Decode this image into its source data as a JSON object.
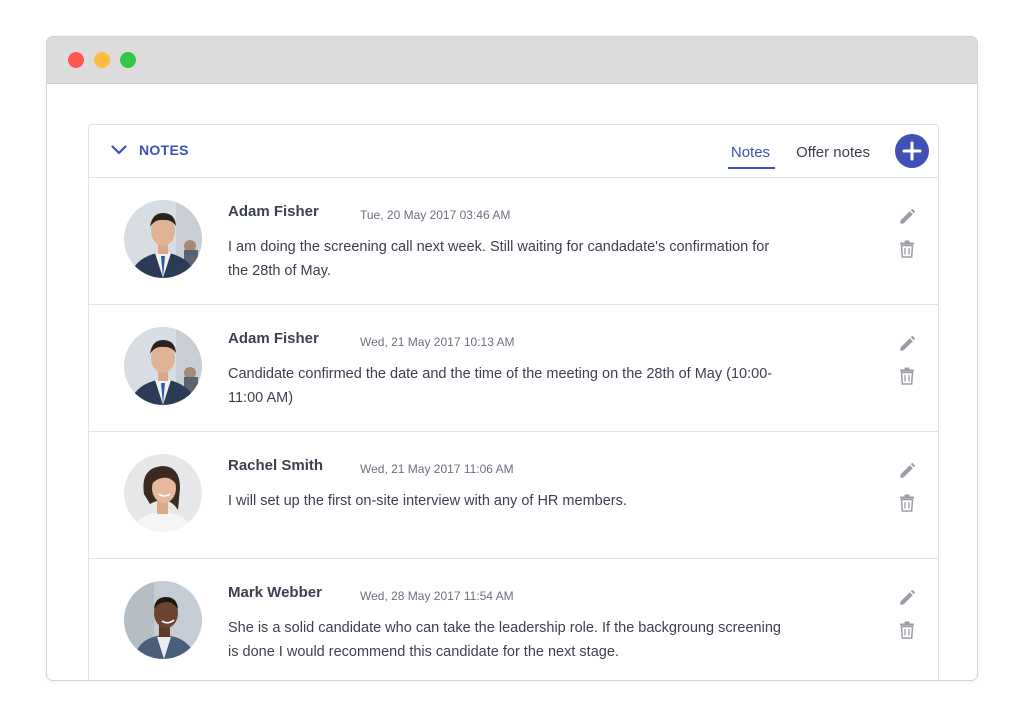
{
  "panel": {
    "title": "NOTES",
    "tabs": [
      {
        "label": "Notes",
        "active": true
      },
      {
        "label": "Offer notes",
        "active": false
      }
    ],
    "add_icon": "plus-icon",
    "collapse_icon": "chevron-down-icon"
  },
  "colors": {
    "accent": "#3f51b5",
    "text": "#3c4150",
    "muted": "#6b7080",
    "icon": "#9a9da6"
  },
  "notes": [
    {
      "author": "Adam Fisher",
      "date": "Tue, 20 May 2017 03:46 AM",
      "text": "I am doing the screening call next week. Still waiting for candadate's confirmation for the 28th of May."
    },
    {
      "author": "Adam Fisher",
      "date": "Wed, 21 May 2017 10:13 AM",
      "text": "Candidate confirmed the date and the time of the meeting on the 28th of May (10:00-11:00 AM)"
    },
    {
      "author": "Rachel Smith",
      "date": "Wed, 21 May 2017 11:06 AM",
      "text": "I will set up the first on-site interview with any of HR members."
    },
    {
      "author": "Mark Webber",
      "date": "Wed, 28 May 2017 11:54 AM",
      "text": "She is a solid candidate who can take the leadership role. If the backgroung screening is done I would recommend this candidate for the next stage."
    }
  ]
}
